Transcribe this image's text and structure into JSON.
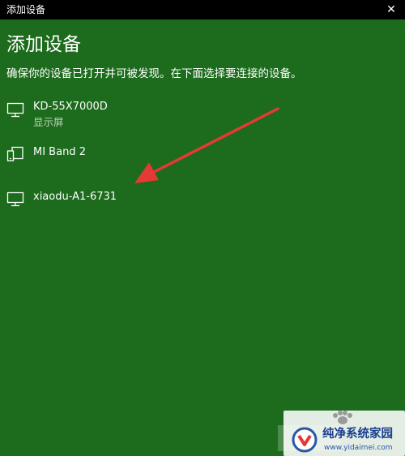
{
  "window": {
    "title": "添加设备",
    "close_glyph": "✕"
  },
  "main": {
    "heading": "添加设备",
    "instruction": "确保你的设备已打开并可被发现。在下面选择要连接的设备。"
  },
  "devices": [
    {
      "name": "KD-55X7000D",
      "subtitle": "显示屏",
      "icon": "monitor-icon"
    },
    {
      "name": "MI Band 2",
      "subtitle": "",
      "icon": "phone-device-icon"
    },
    {
      "name": "xiaodu-A1-6731",
      "subtitle": "",
      "icon": "monitor-icon"
    }
  ],
  "annotation": {
    "arrow_color": "#e53935"
  },
  "watermark": {
    "name": "纯净系统家园",
    "url": "www.yidaimei.com"
  },
  "colors": {
    "background": "#1d6b1d",
    "titlebar": "#000000",
    "text": "#ffffff"
  }
}
